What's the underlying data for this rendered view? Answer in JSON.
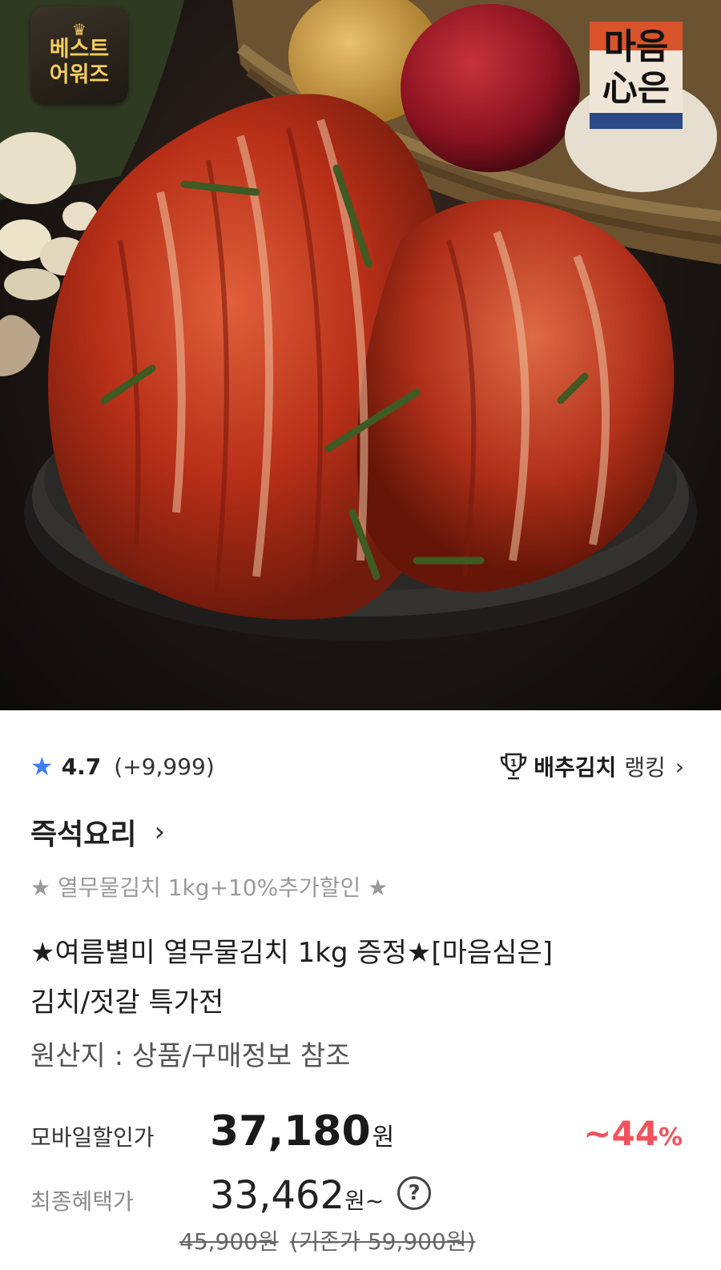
{
  "hero": {
    "badge_line1": "베스트",
    "badge_line2": "어워즈",
    "badge_icon": "crown-icon",
    "brand_logo_text": "마음心은",
    "colors": {
      "kimchi": "#c2341c",
      "bowl": "#2b2a27",
      "background": "#1b1512"
    }
  },
  "rating": {
    "icon": "star-icon",
    "score": "4.7",
    "count": "(+9,999)"
  },
  "ranking": {
    "icon": "trophy-icon",
    "category": "배추김치",
    "label": "랭킹",
    "chevron": "›"
  },
  "category": {
    "label": "즉석요리",
    "chevron": "›"
  },
  "promo_text": "★ 열무물김치 1kg+10%추가할인 ★",
  "product": {
    "title_line1": "★여름별미 열무물김치 1kg 증정★[마음심은]",
    "title_line2": "김치/젓갈 특가전",
    "origin": "원산지 : 상품/구매정보 참조"
  },
  "price": {
    "mobile_label": "모바일할인가",
    "mobile_price": "37,180",
    "won": "원",
    "discount": "~44",
    "discount_pct": "%",
    "final_label": "최종혜택가",
    "final_price": "33,462",
    "final_suffix": "원~",
    "help": "?",
    "original_price": "45,900원",
    "list_price": "(기존가 59,900원)",
    "accent_color": "#f0525c"
  }
}
